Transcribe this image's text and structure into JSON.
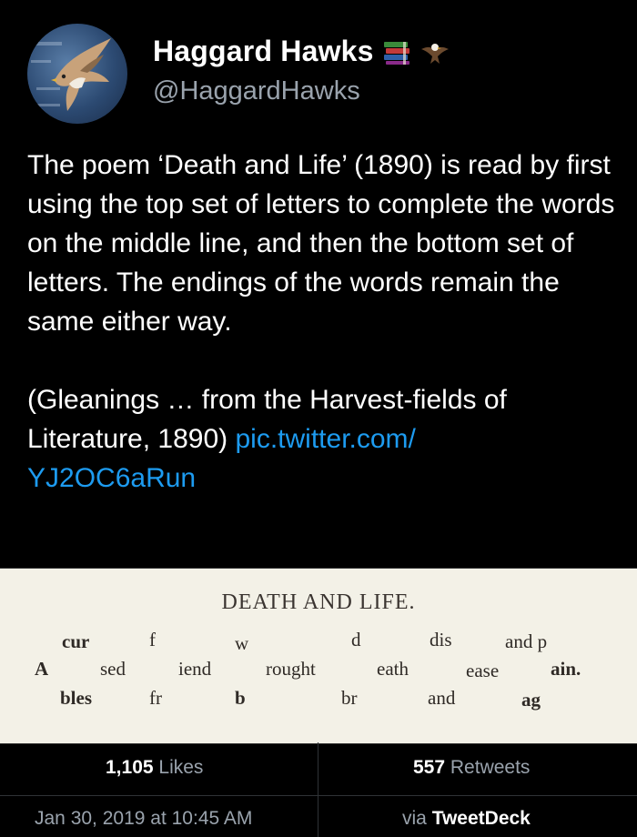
{
  "user": {
    "display_name": "Haggard Hawks",
    "handle": "@HaggardHawks",
    "emoji_icons": [
      "books-icon",
      "eagle-icon"
    ]
  },
  "tweet": {
    "text": "The poem ‘Death and Life’ (1890) is read by first using the top set of letters to complete the words on the middle line, and then the bottom set of letters. The endings of the words remain the same either way.\n\n(Gleanings … from the Harvest-fields of Literature, 1890) ",
    "link_line1": "pic.twitter.com/",
    "link_line2": "YJ2OC6aRun"
  },
  "image": {
    "title": "DEATH AND LIFE.",
    "top": [
      "cur",
      "f",
      "w",
      "d",
      "dis",
      "and p"
    ],
    "middle": [
      "A",
      "sed",
      "iend",
      "rought",
      "eath",
      "ease",
      "ain."
    ],
    "bottom": [
      "bles",
      "fr",
      "b",
      "br",
      "and",
      "ag"
    ]
  },
  "stats": {
    "likes_count": "1,105",
    "likes_label": "Likes",
    "retweets_count": "557",
    "retweets_label": "Retweets"
  },
  "meta": {
    "timestamp": "Jan 30, 2019 at 10:45 AM",
    "via_label": "via",
    "client": "TweetDeck"
  }
}
